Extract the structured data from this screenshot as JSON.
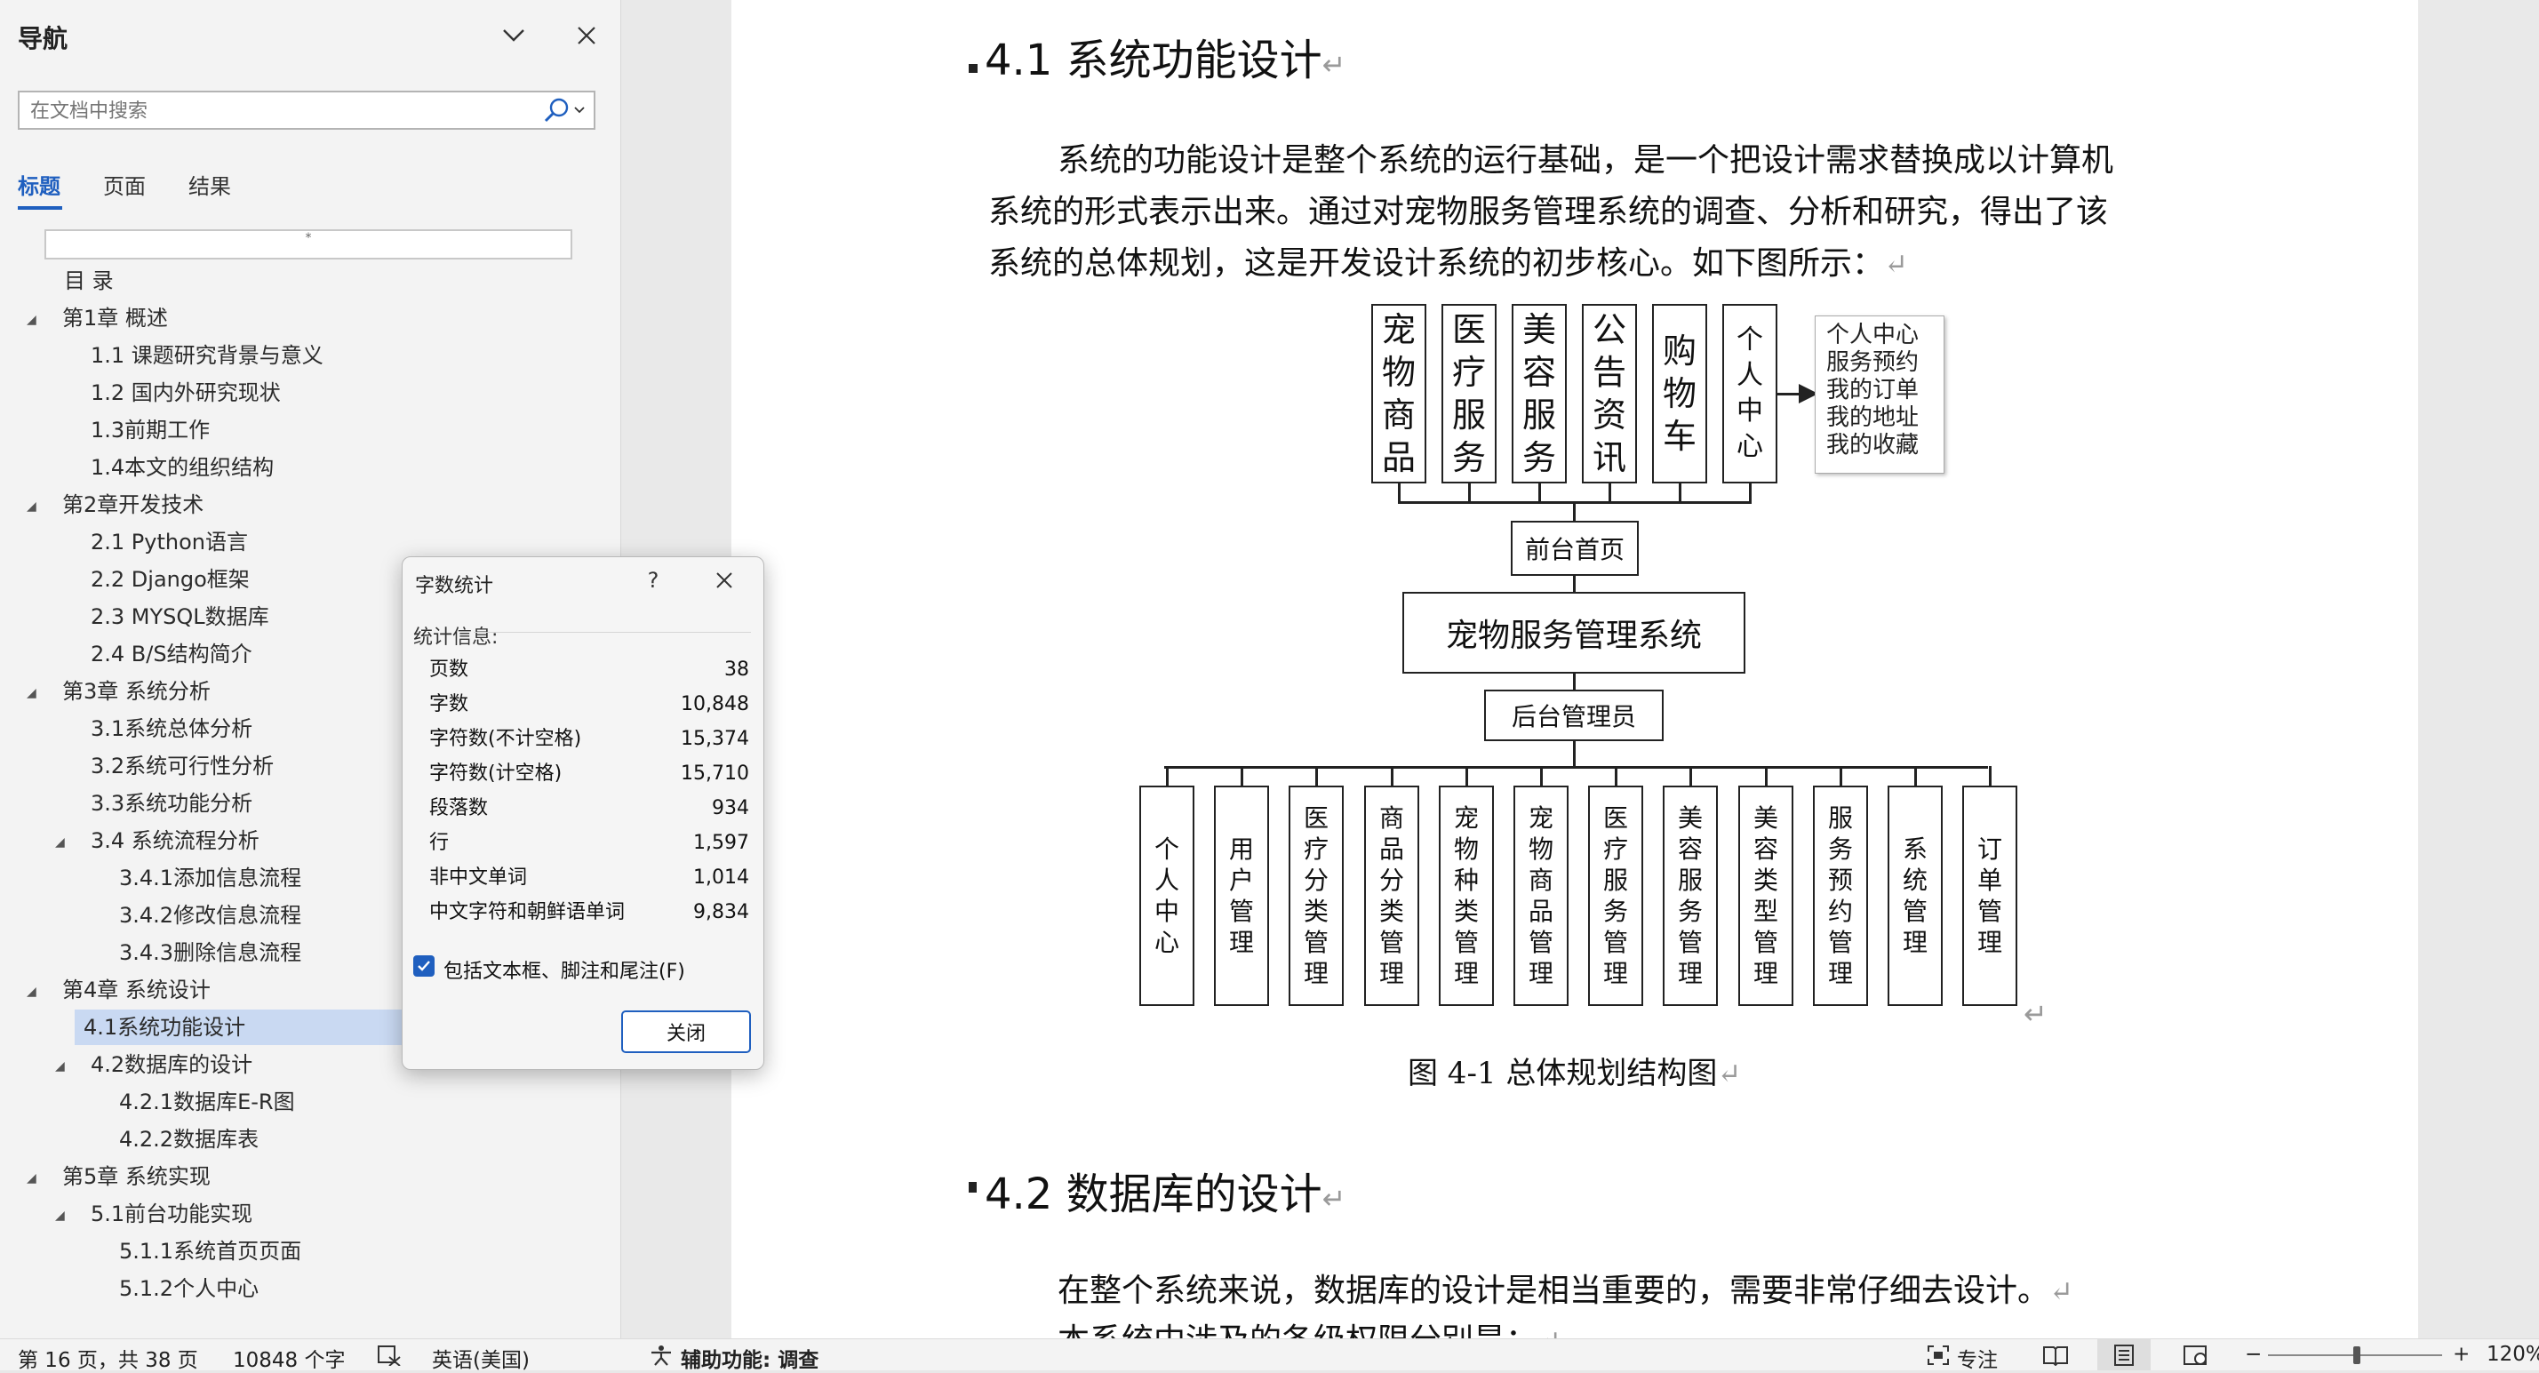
{
  "nav": {
    "title": "导航",
    "search_placeholder": "在文档中搜索",
    "tabs": [
      "标题",
      "页面",
      "结果"
    ],
    "toc_blank": "*",
    "toc": [
      {
        "text": "目  录",
        "level": 1,
        "toggle": false,
        "selected": false
      },
      {
        "text": "第1章 概述",
        "level": 0,
        "toggle": true,
        "selected": false
      },
      {
        "text": "1.1 课题研究背景与意义",
        "level": 1,
        "toggle": false,
        "selected": false
      },
      {
        "text": "1.2 国内外研究现状",
        "level": 1,
        "toggle": false,
        "selected": false
      },
      {
        "text": "1.3前期工作",
        "level": 1,
        "toggle": false,
        "selected": false
      },
      {
        "text": "1.4本文的组织结构",
        "level": 1,
        "toggle": false,
        "selected": false
      },
      {
        "text": "第2章开发技术",
        "level": 0,
        "toggle": true,
        "selected": false
      },
      {
        "text": "2.1 Python语言",
        "level": 1,
        "toggle": false,
        "selected": false
      },
      {
        "text": "2.2 Django框架",
        "level": 1,
        "toggle": false,
        "selected": false
      },
      {
        "text": "2.3 MYSQL数据库",
        "level": 1,
        "toggle": false,
        "selected": false
      },
      {
        "text": "2.4 B/S结构简介",
        "level": 1,
        "toggle": false,
        "selected": false
      },
      {
        "text": "第3章 系统分析",
        "level": 0,
        "toggle": true,
        "selected": false
      },
      {
        "text": "3.1系统总体分析",
        "level": 1,
        "toggle": false,
        "selected": false
      },
      {
        "text": "3.2系统可行性分析",
        "level": 1,
        "toggle": false,
        "selected": false
      },
      {
        "text": "3.3系统功能分析",
        "level": 1,
        "toggle": false,
        "selected": false
      },
      {
        "text": "3.4 系统流程分析",
        "level": 1,
        "toggle": true,
        "selected": false
      },
      {
        "text": "3.4.1添加信息流程",
        "level": 2,
        "toggle": false,
        "selected": false
      },
      {
        "text": "3.4.2修改信息流程",
        "level": 2,
        "toggle": false,
        "selected": false
      },
      {
        "text": "3.4.3删除信息流程",
        "level": 2,
        "toggle": false,
        "selected": false
      },
      {
        "text": "第4章 系统设计",
        "level": 0,
        "toggle": true,
        "selected": false
      },
      {
        "text": "4.1系统功能设计",
        "level": 1,
        "toggle": false,
        "selected": true
      },
      {
        "text": "4.2数据库的设计",
        "level": 1,
        "toggle": true,
        "selected": false
      },
      {
        "text": "4.2.1数据库E-R图",
        "level": 2,
        "toggle": false,
        "selected": false
      },
      {
        "text": "4.2.2数据库表",
        "level": 2,
        "toggle": false,
        "selected": false
      },
      {
        "text": "第5章 系统实现",
        "level": 0,
        "toggle": true,
        "selected": false
      },
      {
        "text": "5.1前台功能实现",
        "level": 1,
        "toggle": true,
        "selected": false
      },
      {
        "text": "5.1.1系统首页页面",
        "level": 2,
        "toggle": false,
        "selected": false
      },
      {
        "text": "5.1.2个人中心",
        "level": 2,
        "toggle": false,
        "selected": false
      }
    ]
  },
  "document": {
    "heading1": "4.1 系统功能设计",
    "para1_lines": [
      "系统的功能设计是整个系统的运行基础，是一个把设计需求替换成以计算机",
      "系统的形式表示出来。通过对宠物服务管理系统的调查、分析和研究，得出了该",
      "系统的总体规划，这是开发设计系统的初步核心。如下图所示："
    ],
    "return_mark": "↵",
    "diagram": {
      "top_modules": [
        "宠物商品",
        "医疗服务",
        "美容服务",
        "公告资讯",
        "购物车",
        "个人中心"
      ],
      "personal_center_items": [
        "个人中心",
        "服务预约",
        "我的订单",
        "我的地址",
        "我的收藏"
      ],
      "front_home": "前台首页",
      "system": "宠物服务管理系统",
      "admin": "后台管理员",
      "bottom_modules": [
        "个人中心",
        "用户管理",
        "医疗分类管理",
        "商品分类管理",
        "宠物种类管理",
        "宠物商品管理",
        "医疗服务管理",
        "美容服务管理",
        "美容类型管理",
        "服务预约管理",
        "系统管理",
        "订单管理"
      ]
    },
    "caption": "图 4-1 总体规划结构图",
    "heading2": "4.2 数据库的设计",
    "para2_line1": "在整个系统来说，数据库的设计是相当重要的，需要非常仔细去设计。",
    "para2_line2": "本系统中涉及的各级权限分别是："
  },
  "dialog": {
    "title": "字数统计",
    "help": "?",
    "heading": "统计信息:",
    "stats": [
      {
        "label": "页数",
        "value": "38"
      },
      {
        "label": "字数",
        "value": "10,848"
      },
      {
        "label": "字符数(不计空格)",
        "value": "15,374"
      },
      {
        "label": "字符数(计空格)",
        "value": "15,710"
      },
      {
        "label": "段落数",
        "value": "934"
      },
      {
        "label": "行",
        "value": "1,597"
      },
      {
        "label": "非中文单词",
        "value": "1,014"
      },
      {
        "label": "中文字符和朝鲜语单词",
        "value": "9,834"
      }
    ],
    "checkbox_label": "包括文本框、脚注和尾注(F)",
    "checkbox_checked": true,
    "close_label": "关闭"
  },
  "status_bar": {
    "page": "第 16 页，共 38 页",
    "words": "10848 个字",
    "language": "英语(美国)",
    "accessibility": "辅助功能: 调查",
    "focus": "专注",
    "zoom": "120%",
    "zoom_minus": "−",
    "zoom_plus": "+"
  },
  "colors": {
    "accent": "#1f5fbf",
    "selection": "#c9d9f2"
  }
}
